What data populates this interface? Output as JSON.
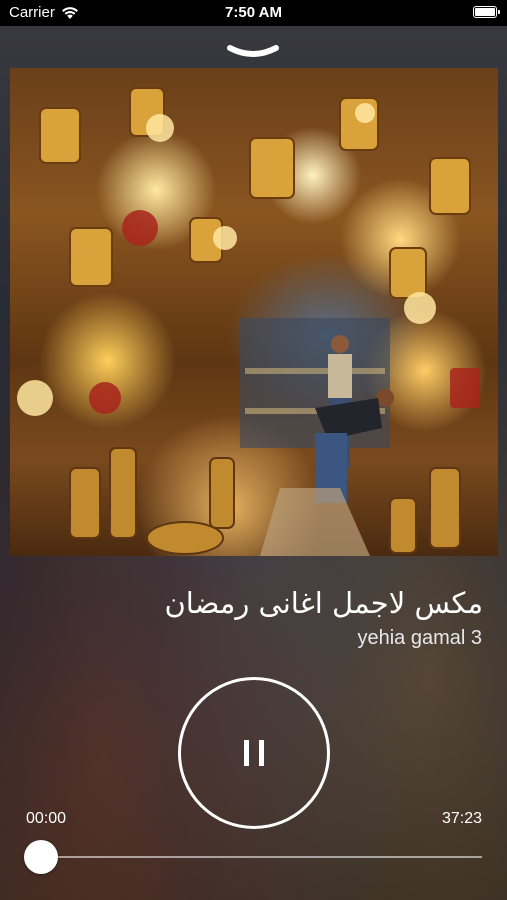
{
  "status_bar": {
    "carrier": "Carrier",
    "time": "7:50 AM"
  },
  "player": {
    "artwork_description": "",
    "track_title": "مكس لاجمل اغانى رمضان",
    "artist": "yehia gamal 3",
    "state": "playing",
    "elapsed": "00:00",
    "duration": "37:23",
    "progress_fraction": 0.0
  },
  "icons": {
    "wifi": "wifi-icon",
    "battery": "battery-icon",
    "collapse": "chevron-down-icon",
    "pause": "pause-icon"
  }
}
